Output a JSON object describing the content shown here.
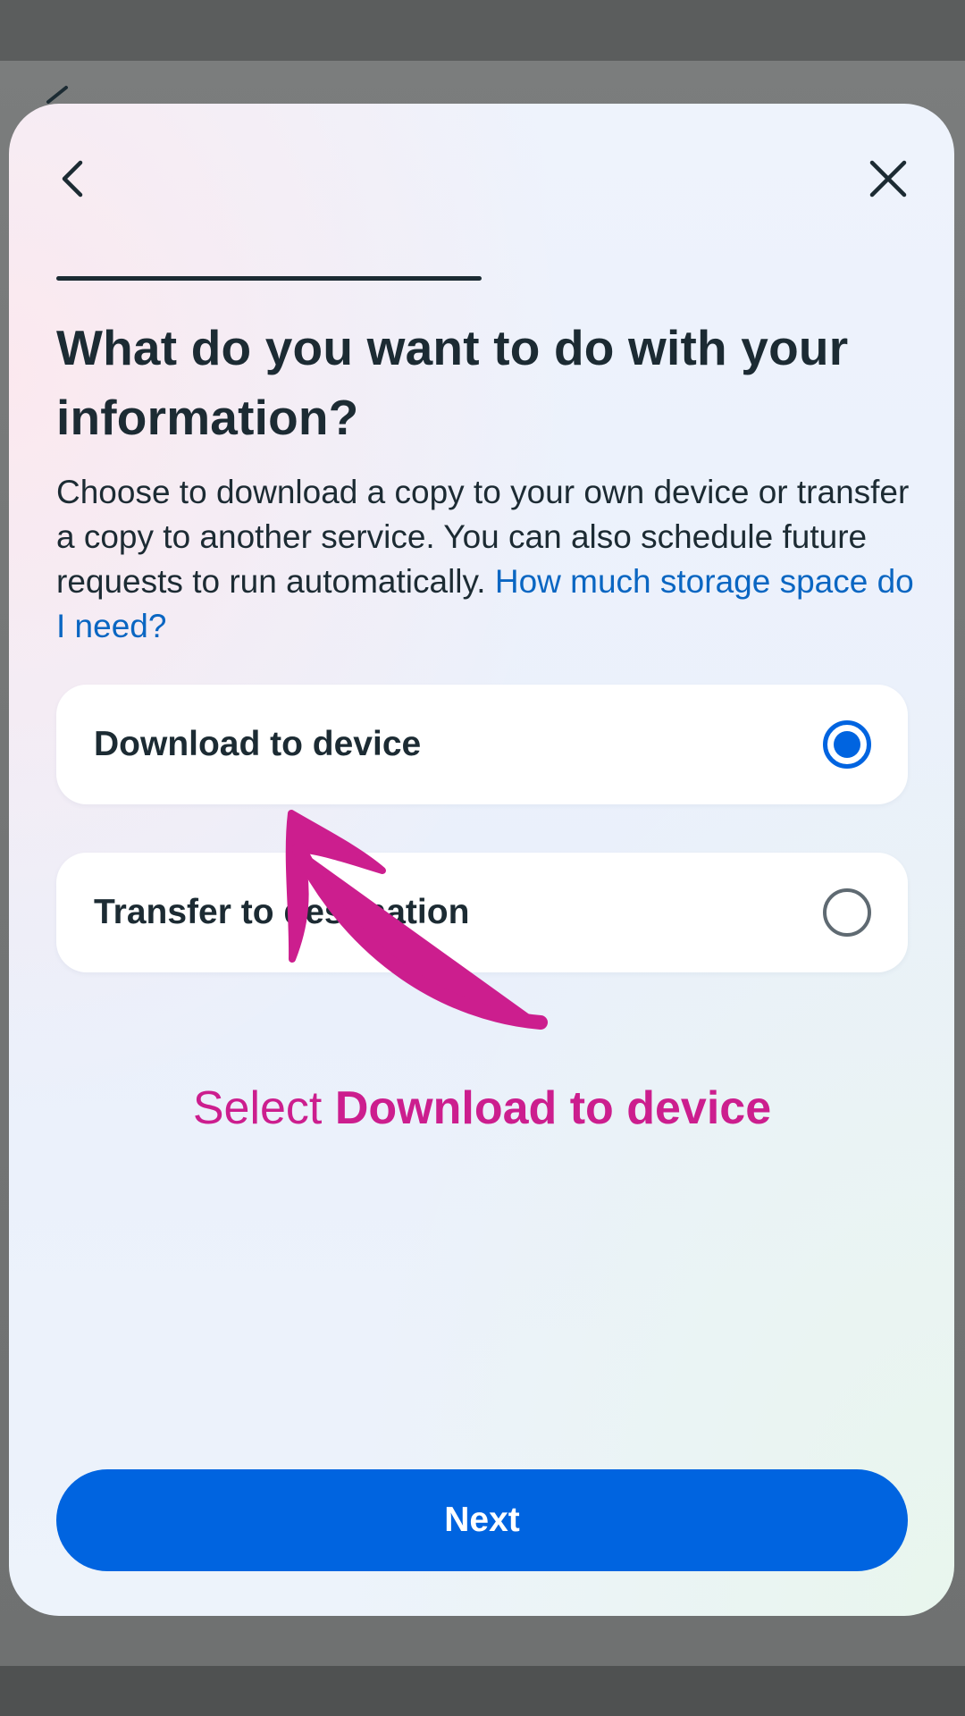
{
  "sheet": {
    "back_icon": "chevron-left-icon",
    "close_icon": "close-icon",
    "title": "What do you want to do with your information?",
    "description": "Choose to download a copy to your own device or transfer a copy to another service. You can also schedule future requests to run automatically.",
    "help_link": "How much storage space do I need?",
    "options": [
      {
        "label": "Download to device",
        "selected": true
      },
      {
        "label": "Transfer to destination",
        "selected": false
      }
    ],
    "next_label": "Next"
  },
  "annotation": {
    "prefix": "Select",
    "emphasis": "Download to device",
    "arrow_icon": "curved-arrow-icon",
    "color": "#cc1e8e"
  },
  "colors": {
    "primary": "#0064e0",
    "link": "#0a66c2",
    "text": "#1c2b33"
  }
}
